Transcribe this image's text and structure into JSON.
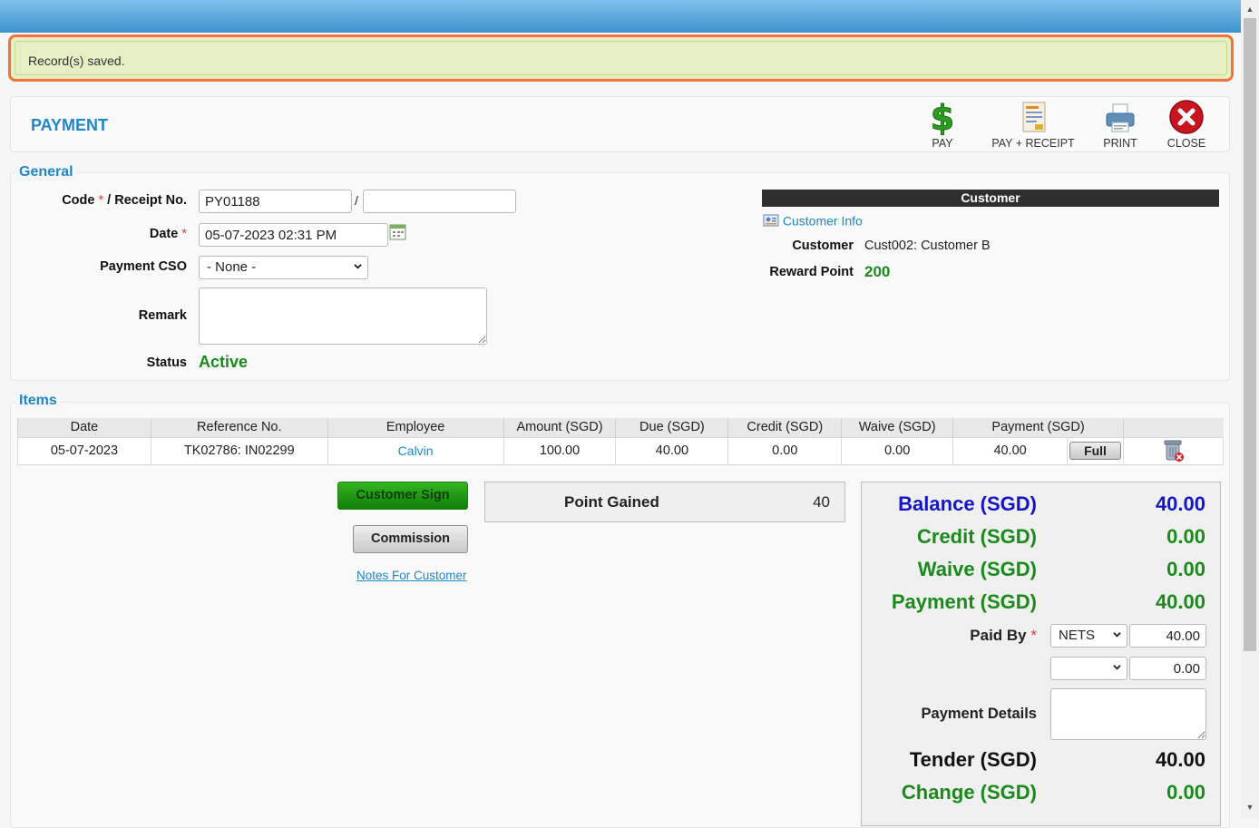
{
  "alert": {
    "message": "Record(s) saved."
  },
  "header": {
    "title": "PAYMENT"
  },
  "toolbar": {
    "pay": "PAY",
    "pay_receipt": "PAY + RECEIPT",
    "print": "PRINT",
    "close": "CLOSE"
  },
  "general": {
    "legend": "General",
    "code_label": "Code",
    "receipt_label": "/ Receipt No.",
    "code_value": "PY01188",
    "receipt_value": "",
    "slash": "/",
    "date_label": "Date",
    "date_value": "05-07-2023 02:31 PM",
    "cso_label": "Payment CSO",
    "cso_value": "- None -",
    "remark_label": "Remark",
    "status_label": "Status",
    "status_value": "Active",
    "required_mark": "*"
  },
  "customer": {
    "header": "Customer",
    "info_link": "Customer Info",
    "customer_label": "Customer",
    "customer_value": "Cust002: Customer B",
    "reward_label": "Reward Point",
    "reward_value": "200"
  },
  "items": {
    "legend": "Items",
    "columns": [
      "Date",
      "Reference No.",
      "Employee",
      "Amount (SGD)",
      "Due (SGD)",
      "Credit (SGD)",
      "Waive (SGD)",
      "Payment (SGD)"
    ],
    "rows": [
      {
        "date": "05-07-2023",
        "ref": "TK02786: IN02299",
        "employee": "Calvin",
        "amount": "100.00",
        "due": "40.00",
        "credit": "0.00",
        "waive": "0.00",
        "payment": "40.00",
        "full_label": "Full"
      }
    ]
  },
  "actions": {
    "customer_sign": "Customer Sign",
    "commission": "Commission",
    "notes_link": "Notes For Customer"
  },
  "points": {
    "label": "Point Gained",
    "value": "40"
  },
  "summary": {
    "balance_label": "Balance (SGD)",
    "balance_value": "40.00",
    "credit_label": "Credit (SGD)",
    "credit_value": "0.00",
    "waive_label": "Waive (SGD)",
    "waive_value": "0.00",
    "payment_label": "Payment (SGD)",
    "payment_value": "40.00",
    "paid_by_label": "Paid By",
    "paid_by_1_method": "NETS",
    "paid_by_1_amount": "40.00",
    "paid_by_2_method": "",
    "paid_by_2_amount": "0.00",
    "payment_details_label": "Payment Details",
    "tender_label": "Tender (SGD)",
    "tender_value": "40.00",
    "change_label": "Change (SGD)",
    "change_value": "0.00"
  },
  "colors": {
    "accent": "#1f86c8",
    "green": "#1a8a1a",
    "blue": "#1515c8",
    "required": "#e03a3a",
    "alert_border": "#f0743a"
  }
}
